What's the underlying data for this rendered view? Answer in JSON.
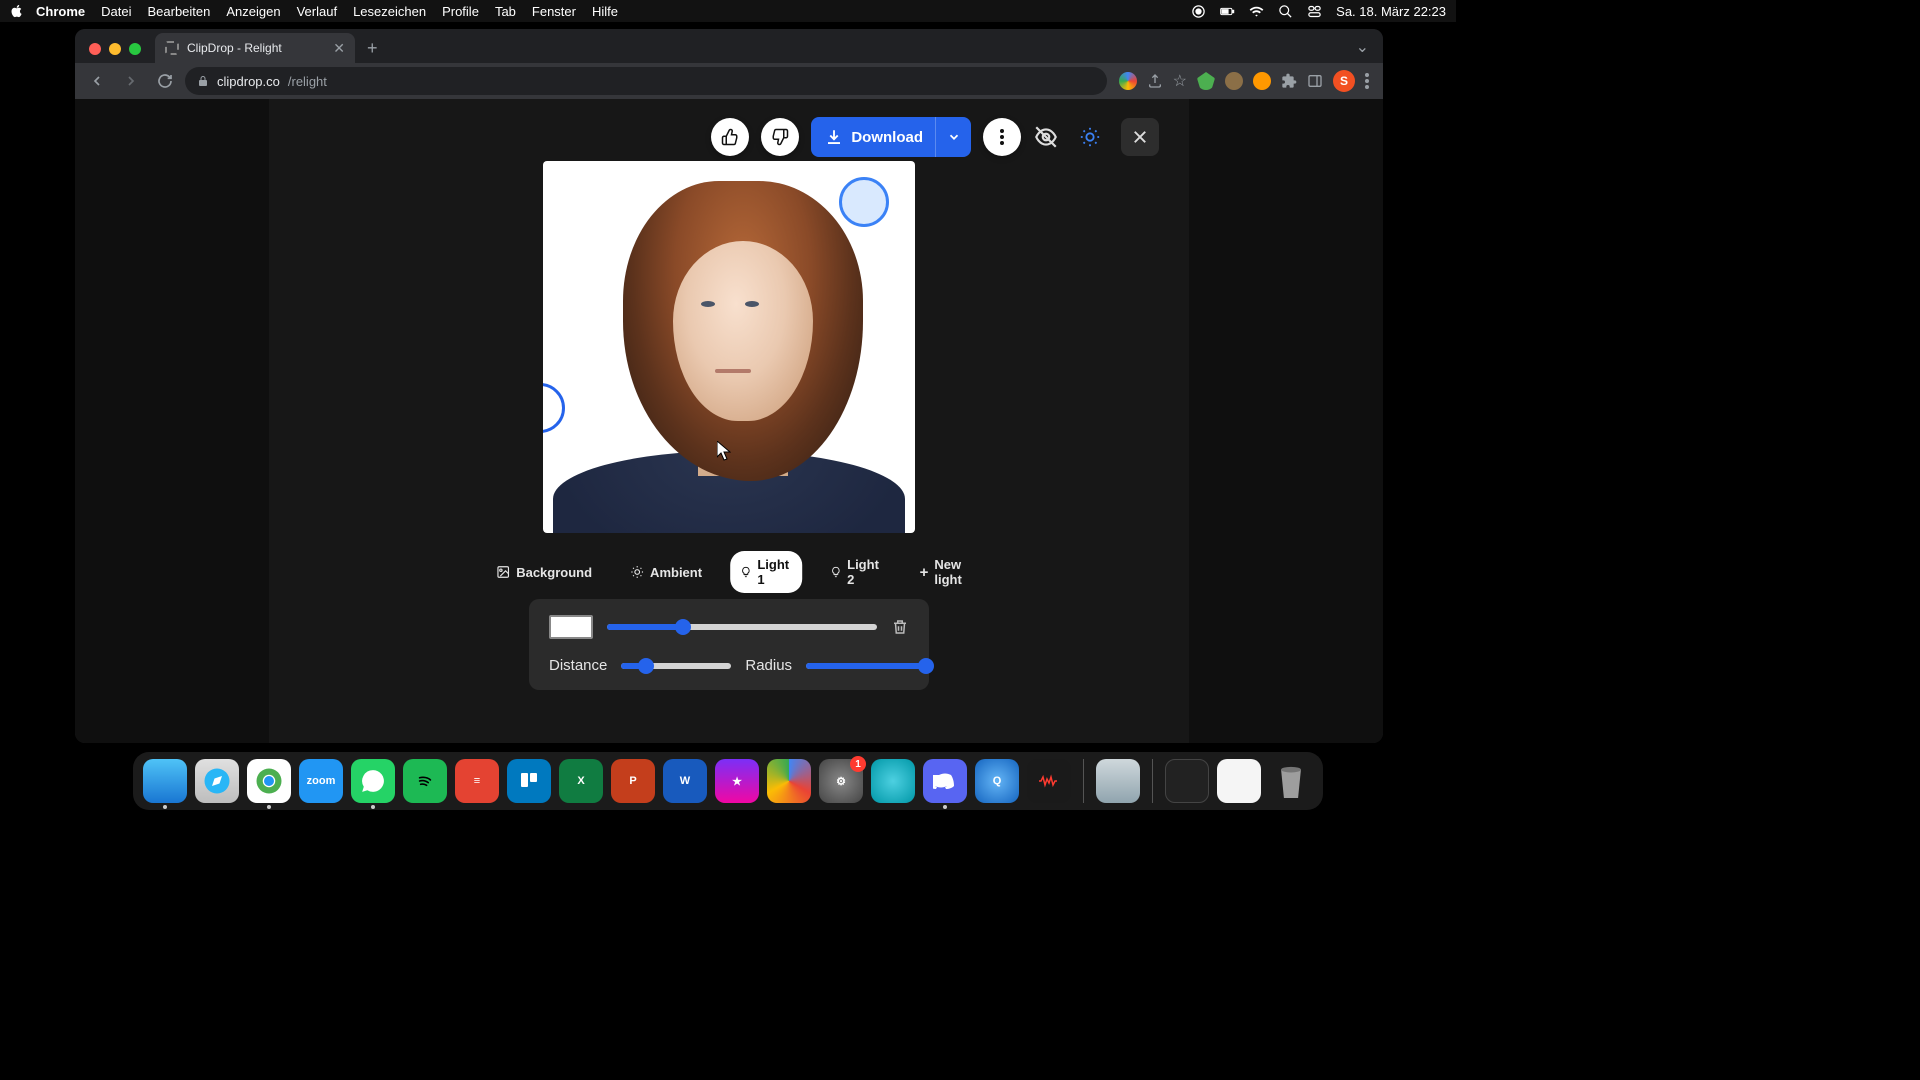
{
  "menubar": {
    "app": "Chrome",
    "items": [
      "Datei",
      "Bearbeiten",
      "Anzeigen",
      "Verlauf",
      "Lesezeichen",
      "Profile",
      "Tab",
      "Fenster",
      "Hilfe"
    ],
    "clock": "Sa. 18. März  22:23"
  },
  "browser": {
    "tab_title": "ClipDrop - Relight",
    "url_host": "clipdrop.co",
    "url_path": "/relight",
    "avatar_initial": "S"
  },
  "actions": {
    "download_label": "Download"
  },
  "light_tabs": {
    "background": "Background",
    "ambient": "Ambient",
    "light1": "Light 1",
    "light2": "Light 2",
    "newlight": "New light"
  },
  "controls": {
    "distance_label": "Distance",
    "radius_label": "Radius",
    "intensity_pct": 28,
    "distance_pct": 22,
    "radius_pct": 100
  },
  "dock": {
    "settings_badge": "1"
  }
}
